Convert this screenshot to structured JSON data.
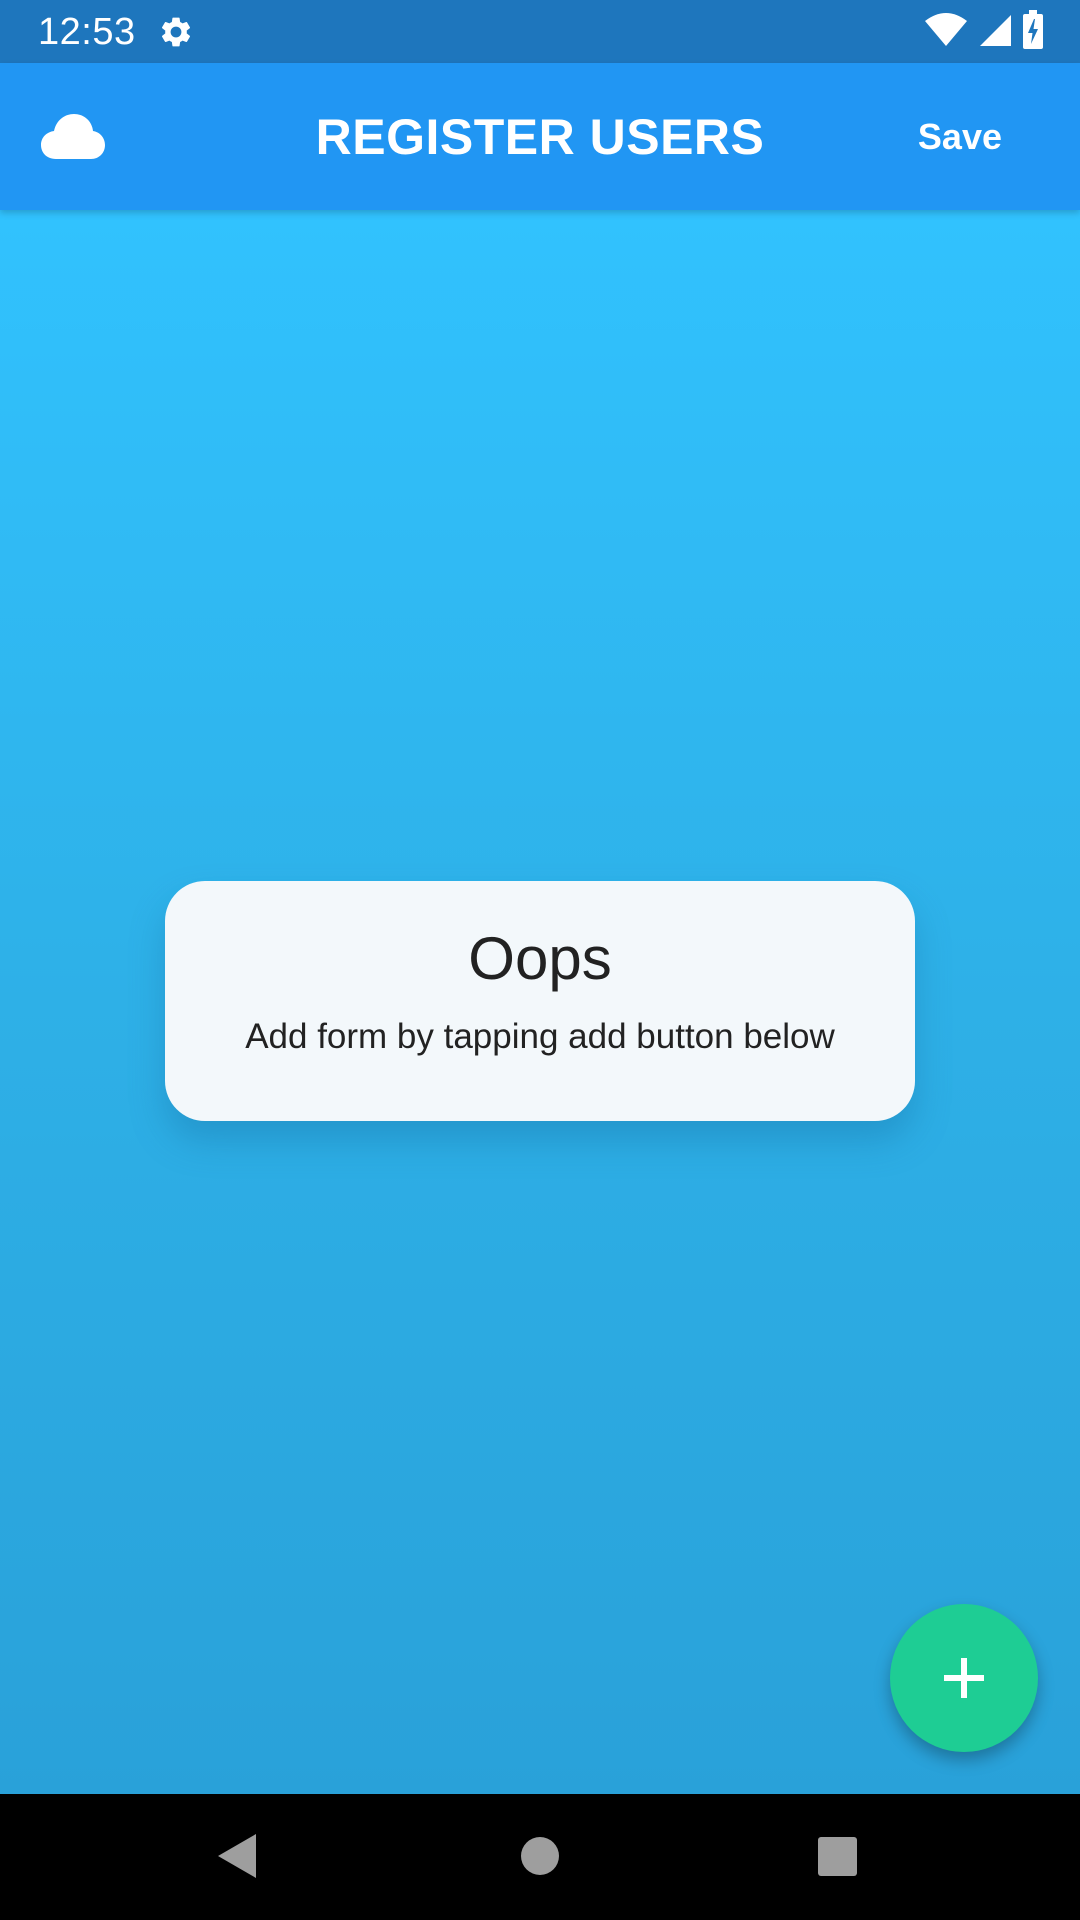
{
  "status_bar": {
    "time": "12:53",
    "icons": [
      "gear-icon",
      "wifi-icon",
      "signal-icon",
      "battery-charging-icon"
    ],
    "color": "#1e76bd"
  },
  "app_bar": {
    "left_icon": "cloud-icon",
    "title": "REGISTER USERS",
    "save_label": "Save",
    "color": "#2196f3"
  },
  "empty_state": {
    "title": "Oops",
    "message": "Add form by tapping add button below"
  },
  "fab": {
    "icon": "plus-icon",
    "color": "#1ecd94"
  },
  "nav_bar": {
    "buttons": [
      "back-icon",
      "home-icon",
      "recents-icon"
    ]
  },
  "colors": {
    "background_top": "#31c2fe",
    "background_bottom": "#29a1d9",
    "card": "#f3f8fb"
  }
}
